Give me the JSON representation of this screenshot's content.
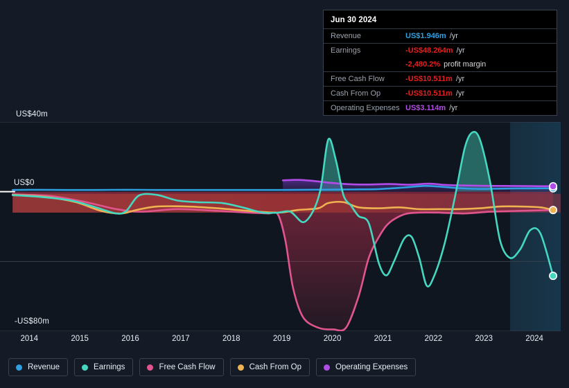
{
  "chart_data": {
    "type": "area",
    "title": "",
    "xlabel": "",
    "ylabel": "",
    "ylim": [
      -80,
      40
    ],
    "xlim": [
      2013.5,
      2024.6
    ],
    "grid": true,
    "legend_position": "bottom",
    "y_ticks": [
      {
        "value": 40,
        "label": "US$40m"
      },
      {
        "value": 0,
        "label": "US$0"
      },
      {
        "value": -80,
        "label": "-US$80m"
      }
    ],
    "x_ticks": [
      "2014",
      "2015",
      "2016",
      "2017",
      "2018",
      "2019",
      "2020",
      "2021",
      "2022",
      "2023",
      "2024"
    ],
    "forecast_region_start": "2023.6",
    "series": [
      {
        "name": "Revenue",
        "color": "#2e9fe0",
        "end_value": 1.946,
        "x": [
          2013.75,
          2014.2,
          2014.8,
          2015.4,
          2016.0,
          2016.6,
          2017.2,
          2017.8,
          2018.4,
          2019.0,
          2019.5,
          2020.0,
          2020.5,
          2021.0,
          2021.5,
          2021.9,
          2022.2,
          2022.6,
          2023.0,
          2023.5,
          2024.0,
          2024.45
        ],
        "values": [
          1.0,
          1.1,
          1.0,
          1.0,
          1.1,
          1.0,
          1.0,
          1.0,
          1.0,
          1.0,
          1.1,
          1.2,
          1.3,
          1.5,
          2.4,
          3.3,
          2.9,
          2.0,
          1.6,
          1.8,
          1.9,
          1.946
        ]
      },
      {
        "name": "Earnings",
        "color": "#45d7c0",
        "end_value": -48.264,
        "x": [
          2013.75,
          2014.3,
          2014.9,
          2015.4,
          2015.8,
          2016.0,
          2016.25,
          2016.6,
          2017.0,
          2017.4,
          2017.9,
          2018.3,
          2018.7,
          2019.0,
          2019.25,
          2019.5,
          2019.7,
          2019.85,
          2020.0,
          2020.15,
          2020.3,
          2020.45,
          2020.6,
          2020.8,
          2021.0,
          2021.15,
          2021.3,
          2021.5,
          2021.65,
          2021.8,
          2021.95,
          2022.1,
          2022.3,
          2022.5,
          2022.7,
          2022.85,
          2023.0,
          2023.2,
          2023.4,
          2023.6,
          2023.8,
          2024.0,
          2024.2,
          2024.45
        ],
        "values": [
          -2.0,
          -3.0,
          -5.0,
          -9.0,
          -12.5,
          -11.0,
          -2.2,
          -1.8,
          -5.0,
          -6.0,
          -6.5,
          -9.0,
          -12.0,
          -12.0,
          -11.5,
          -17.5,
          -11.0,
          2.0,
          30.0,
          18.0,
          -2.0,
          -8.0,
          -14.0,
          -18.0,
          -41.0,
          -48.0,
          -40.0,
          -27.0,
          -26.0,
          -38.0,
          -54.0,
          -48.0,
          -30.0,
          -4.0,
          25.0,
          34.0,
          30.0,
          6.0,
          -28.0,
          -38.0,
          -33.0,
          -22.0,
          -24.0,
          -48.264
        ]
      },
      {
        "name": "Free Cash Flow",
        "color": "#e0558e",
        "end_value": -10.511,
        "x": [
          2013.75,
          2014.5,
          2015.2,
          2015.8,
          2016.3,
          2017.0,
          2017.8,
          2018.4,
          2018.8,
          2019.0,
          2019.15,
          2019.3,
          2019.5,
          2019.8,
          2020.1,
          2020.35,
          2020.6,
          2020.8,
          2021.0,
          2021.2,
          2021.5,
          2021.8,
          2022.2,
          2022.7,
          2023.2,
          2023.8,
          2024.2,
          2024.45
        ],
        "values": [
          -1.5,
          -2.5,
          -6.0,
          -10.0,
          -11.5,
          -10.0,
          -11.0,
          -12.0,
          -12.5,
          -13.0,
          -28.0,
          -55.0,
          -72.0,
          -78.0,
          -79.0,
          -78.0,
          -60.0,
          -38.0,
          -26.0,
          -18.0,
          -13.0,
          -12.0,
          -12.0,
          -12.5,
          -11.5,
          -11.0,
          -10.7,
          -10.511
        ]
      },
      {
        "name": "Cash From Op",
        "color": "#efb251",
        "end_value": -10.511,
        "x": [
          2013.75,
          2014.4,
          2015.0,
          2015.5,
          2015.9,
          2016.2,
          2016.6,
          2017.2,
          2017.8,
          2018.4,
          2019.0,
          2019.4,
          2019.8,
          2020.0,
          2020.3,
          2020.6,
          2021.0,
          2021.4,
          2021.8,
          2022.2,
          2022.6,
          2023.0,
          2023.4,
          2023.8,
          2024.2,
          2024.45
        ],
        "values": [
          -1.8,
          -3.0,
          -6.0,
          -11.0,
          -12.5,
          -10.5,
          -8.5,
          -8.5,
          -9.5,
          -11.0,
          -12.0,
          -10.5,
          -9.5,
          -6.5,
          -6.0,
          -9.0,
          -9.5,
          -9.0,
          -10.0,
          -10.0,
          -10.0,
          -9.5,
          -8.5,
          -8.5,
          -9.0,
          -10.511
        ]
      },
      {
        "name": "Operating Expenses",
        "color": "#b14ce8",
        "end_value": 3.114,
        "x": [
          2019.1,
          2019.4,
          2019.7,
          2020.0,
          2020.4,
          2020.8,
          2021.2,
          2021.6,
          2022.0,
          2022.3,
          2022.6,
          2023.0,
          2023.5,
          2024.0,
          2024.45
        ],
        "values": [
          6.5,
          6.8,
          6.2,
          5.2,
          4.3,
          4.1,
          4.4,
          4.0,
          4.6,
          3.9,
          3.6,
          3.4,
          3.3,
          3.2,
          3.114
        ]
      }
    ]
  },
  "tooltip": {
    "date": "Jun 30 2024",
    "rows": [
      {
        "label": "Revenue",
        "value": "US$1.946m",
        "unit": "/yr",
        "color": "#2e9fe0"
      },
      {
        "label": "Earnings",
        "value": "-US$48.264m",
        "unit": "/yr",
        "color": "#e52020"
      },
      {
        "label": "",
        "value": "-2,480.2%",
        "unit": "profit margin",
        "color": "#e52020"
      },
      {
        "label": "Free Cash Flow",
        "value": "-US$10.511m",
        "unit": "/yr",
        "color": "#e52020"
      },
      {
        "label": "Cash From Op",
        "value": "-US$10.511m",
        "unit": "/yr",
        "color": "#e52020"
      },
      {
        "label": "Operating Expenses",
        "value": "US$3.114m",
        "unit": "/yr",
        "color": "#b14ce8"
      }
    ]
  },
  "legend": {
    "items": [
      {
        "label": "Revenue",
        "color": "#2e9fe0"
      },
      {
        "label": "Earnings",
        "color": "#45d7c0"
      },
      {
        "label": "Free Cash Flow",
        "color": "#e0558e"
      },
      {
        "label": "Cash From Op",
        "color": "#efb251"
      },
      {
        "label": "Operating Expenses",
        "color": "#b14ce8"
      }
    ]
  }
}
